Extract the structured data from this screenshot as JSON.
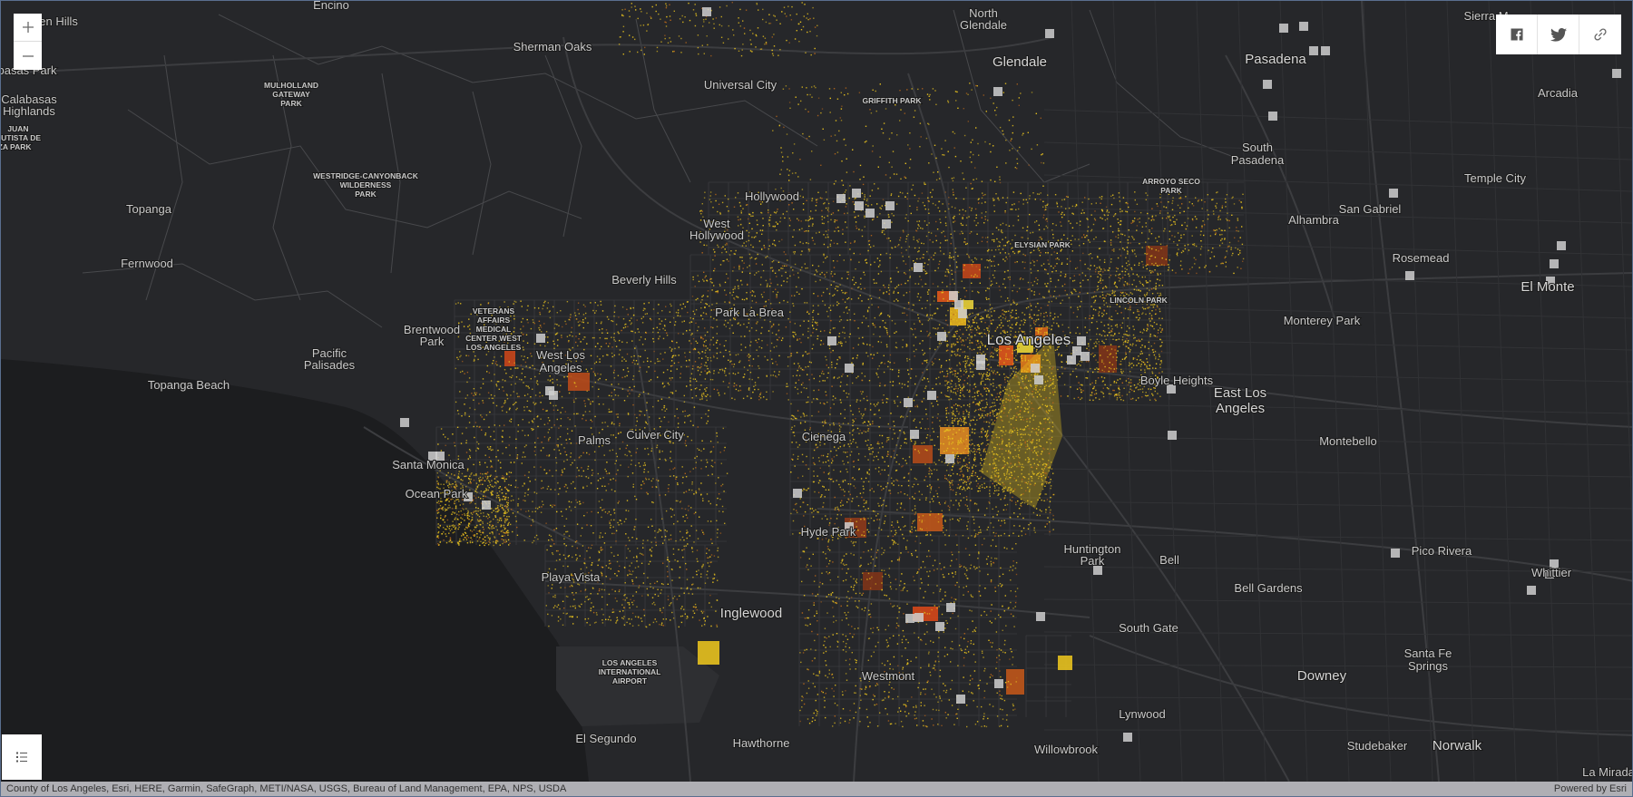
{
  "controls": {
    "zoom_in_icon": "plus-icon",
    "zoom_out_icon": "minus-icon",
    "legend_icon": "list-icon",
    "share": [
      "facebook-icon",
      "twitter-icon",
      "link-icon"
    ]
  },
  "attribution": {
    "sources": "County of Los Angeles, Esri, HERE, Garmin, SafeGraph, METI/NASA, USGS, Bureau of Land Management, EPA, NPS, USDA",
    "powered_by": "Powered by Esri"
  },
  "colors": {
    "map_bg": "#26272a",
    "ocean": "#1c1d1f",
    "road": "#3c3d40",
    "boundary": "#48494c",
    "dot": "#e8c21e",
    "hot": "#e0561a",
    "marker": "#cfcfcf"
  },
  "labels": [
    {
      "text": "Encino",
      "cls": "city"
    },
    {
      "text": "den Hills",
      "cls": "city"
    },
    {
      "text": "Sherman Oaks",
      "cls": "city"
    },
    {
      "text": "North",
      "cls": "city"
    },
    {
      "text": "Glendale",
      "cls": "city"
    },
    {
      "text": "Glendale",
      "cls": "major"
    },
    {
      "text": "Sierra M",
      "cls": "city"
    },
    {
      "text": "Pasadena",
      "cls": "major"
    },
    {
      "text": "basas Park",
      "cls": "city"
    },
    {
      "text": "Universal City",
      "cls": "city"
    },
    {
      "text": "MULHOLLAND",
      "cls": "park"
    },
    {
      "text": "GATEWAY",
      "cls": "park"
    },
    {
      "text": "PARK",
      "cls": "park"
    },
    {
      "text": "GRIFFITH PARK",
      "cls": "park"
    },
    {
      "text": "Arcadia",
      "cls": "city"
    },
    {
      "text": "Calabasas",
      "cls": "city"
    },
    {
      "text": "Highlands",
      "cls": "city"
    },
    {
      "text": "JUAN",
      "cls": "park"
    },
    {
      "text": "AUTISTA DE",
      "cls": "park"
    },
    {
      "text": "NZA PARK",
      "cls": "park"
    },
    {
      "text": "South",
      "cls": "city"
    },
    {
      "text": "Pasadena",
      "cls": "city"
    },
    {
      "text": "WESTRIDGE-CANYONBACK",
      "cls": "park"
    },
    {
      "text": "WILDERNESS",
      "cls": "park"
    },
    {
      "text": "PARK",
      "cls": "park"
    },
    {
      "text": "ARROYO SECO",
      "cls": "park"
    },
    {
      "text": "PARK",
      "cls": "park"
    },
    {
      "text": "Temple City",
      "cls": "city"
    },
    {
      "text": "Hollywood",
      "cls": "city"
    },
    {
      "text": "Topanga",
      "cls": "city"
    },
    {
      "text": "San Gabriel",
      "cls": "city"
    },
    {
      "text": "Alhambra",
      "cls": "city"
    },
    {
      "text": "West",
      "cls": "city"
    },
    {
      "text": "Hollywood",
      "cls": "city"
    },
    {
      "text": "ELYSIAN PARK",
      "cls": "park"
    },
    {
      "text": "Rosemead",
      "cls": "city"
    },
    {
      "text": "Fernwood",
      "cls": "city"
    },
    {
      "text": "Beverly Hills",
      "cls": "city"
    },
    {
      "text": "El Monte",
      "cls": "major"
    },
    {
      "text": "LINCOLN PARK",
      "cls": "park"
    },
    {
      "text": "Park La Brea",
      "cls": "city"
    },
    {
      "text": "VETERANS",
      "cls": "park"
    },
    {
      "text": "AFFAIRS",
      "cls": "park"
    },
    {
      "text": "MEDICAL",
      "cls": "park"
    },
    {
      "text": "CENTER WEST",
      "cls": "park"
    },
    {
      "text": "LOS ANGELES",
      "cls": "park"
    },
    {
      "text": "Monterey Park",
      "cls": "city"
    },
    {
      "text": "Brentwood",
      "cls": "city"
    },
    {
      "text": "Park",
      "cls": "city"
    },
    {
      "text": "Los Angeles",
      "cls": "big"
    },
    {
      "text": "Pacific",
      "cls": "city"
    },
    {
      "text": "Palisades",
      "cls": "city"
    },
    {
      "text": "West Los",
      "cls": "city"
    },
    {
      "text": "Angeles",
      "cls": "city"
    },
    {
      "text": "Boyle Heights",
      "cls": "city"
    },
    {
      "text": "Topanga Beach",
      "cls": "city"
    },
    {
      "text": "East Los",
      "cls": "major"
    },
    {
      "text": "Angeles",
      "cls": "major"
    },
    {
      "text": "Palms",
      "cls": "city"
    },
    {
      "text": "Culver City",
      "cls": "city"
    },
    {
      "text": "Cienega",
      "cls": "city"
    },
    {
      "text": "Montebello",
      "cls": "city"
    },
    {
      "text": "Santa Monica",
      "cls": "city"
    },
    {
      "text": "Ocean Park",
      "cls": "city"
    },
    {
      "text": "Hyde Park",
      "cls": "city"
    },
    {
      "text": "Huntington",
      "cls": "city"
    },
    {
      "text": "Park",
      "cls": "city"
    },
    {
      "text": "Bell",
      "cls": "city"
    },
    {
      "text": "Pico Rivera",
      "cls": "city"
    },
    {
      "text": "Whittier",
      "cls": "city"
    },
    {
      "text": "Playa Vista",
      "cls": "city"
    },
    {
      "text": "Bell Gardens",
      "cls": "city"
    },
    {
      "text": "Inglewood",
      "cls": "major"
    },
    {
      "text": "South Gate",
      "cls": "city"
    },
    {
      "text": "LOS ANGELES",
      "cls": "park"
    },
    {
      "text": "INTERNATIONAL",
      "cls": "park"
    },
    {
      "text": "AIRPORT",
      "cls": "park"
    },
    {
      "text": "Santa Fe",
      "cls": "city"
    },
    {
      "text": "Springs",
      "cls": "city"
    },
    {
      "text": "Westmont",
      "cls": "city"
    },
    {
      "text": "Downey",
      "cls": "major"
    },
    {
      "text": "Lynwood",
      "cls": "city"
    },
    {
      "text": "El Segundo",
      "cls": "city"
    },
    {
      "text": "Hawthorne",
      "cls": "city"
    },
    {
      "text": "Willowbrook",
      "cls": "city"
    },
    {
      "text": "Studebaker",
      "cls": "city"
    },
    {
      "text": "Norwalk",
      "cls": "major"
    },
    {
      "text": "La Mirada",
      "cls": "city"
    }
  ]
}
